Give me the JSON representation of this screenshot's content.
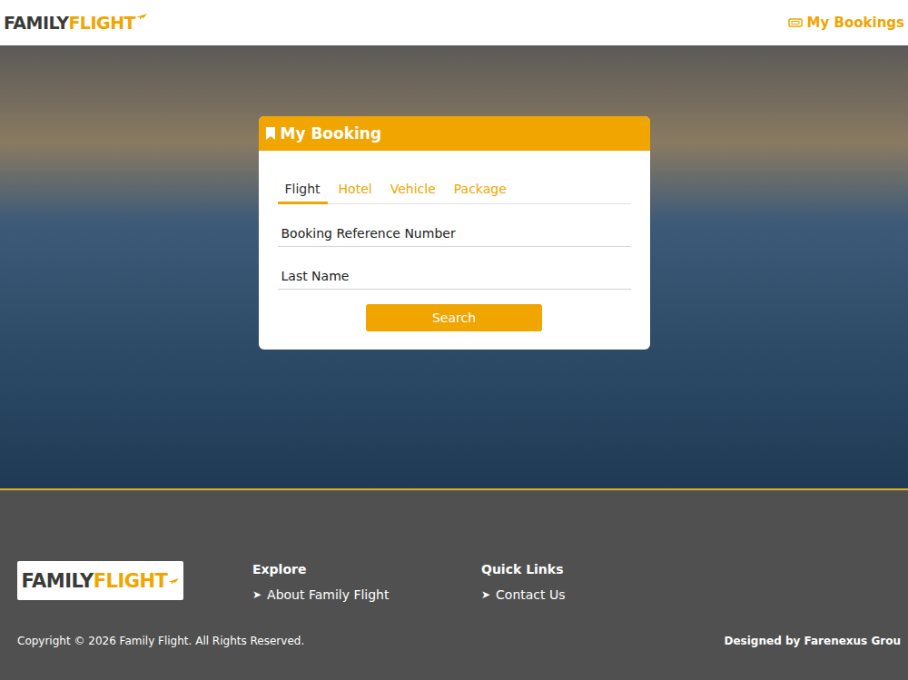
{
  "header": {
    "logo": {
      "dark": "FAMILY",
      "accent": "FLIGHT"
    },
    "my_bookings": "My Bookings"
  },
  "card": {
    "title": "My Booking",
    "tabs": [
      {
        "label": "Flight",
        "selected": true
      },
      {
        "label": "Hotel",
        "selected": false
      },
      {
        "label": "Vehicle",
        "selected": false
      },
      {
        "label": "Package",
        "selected": false
      }
    ],
    "fields": [
      {
        "placeholder": "Booking Reference Number"
      },
      {
        "placeholder": "Last Name"
      }
    ],
    "button": "Search"
  },
  "footer": {
    "logo": {
      "dark": "FAMILY",
      "accent": "FLIGHT"
    },
    "columns": [
      {
        "heading": "Explore",
        "links": [
          {
            "arrow": "➤",
            "label": "About Family Flight"
          }
        ]
      },
      {
        "heading": "Quick Links",
        "links": [
          {
            "arrow": "➤",
            "label": "Contact Us"
          }
        ]
      }
    ],
    "copyright": "Copyright © 2026 Family Flight. All Rights Reserved.",
    "designed_by": "Designed by Farenexus Grou"
  }
}
